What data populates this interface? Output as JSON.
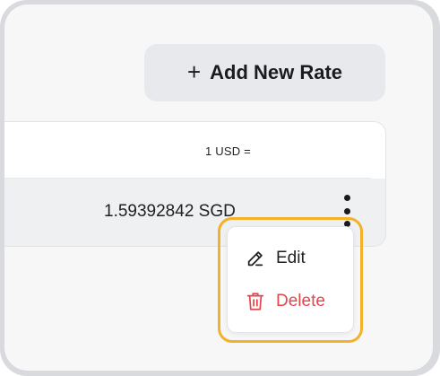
{
  "toolbar": {
    "add_label": "Add New Rate",
    "add_icon": "plus-icon"
  },
  "table": {
    "header": "1 USD =",
    "rows": [
      {
        "rate": "1.59392842 SGD"
      }
    ]
  },
  "context_menu": {
    "items": [
      {
        "label": "Edit",
        "icon": "pencil-icon",
        "color": "#1f2024"
      },
      {
        "label": "Delete",
        "icon": "trash-icon",
        "color": "#e2474c"
      }
    ],
    "highlight_color": "#f3b12a"
  }
}
